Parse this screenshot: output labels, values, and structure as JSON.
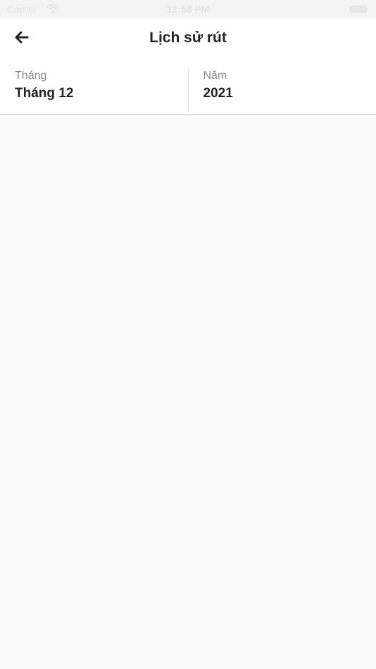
{
  "status_bar": {
    "carrier": "Carrier",
    "time": "12:58 PM"
  },
  "header": {
    "title": "Lịch sử rút",
    "back_icon": "arrow-left-icon"
  },
  "filters": {
    "month": {
      "label": "Tháng",
      "value": "Tháng 12"
    },
    "year": {
      "label": "Năm",
      "value": "2021"
    }
  },
  "colors": {
    "background": "#fafafa",
    "header_bg": "#ffffff",
    "text_primary": "#222222",
    "text_secondary": "#8a8a8a",
    "divider": "#d8d8d8"
  }
}
